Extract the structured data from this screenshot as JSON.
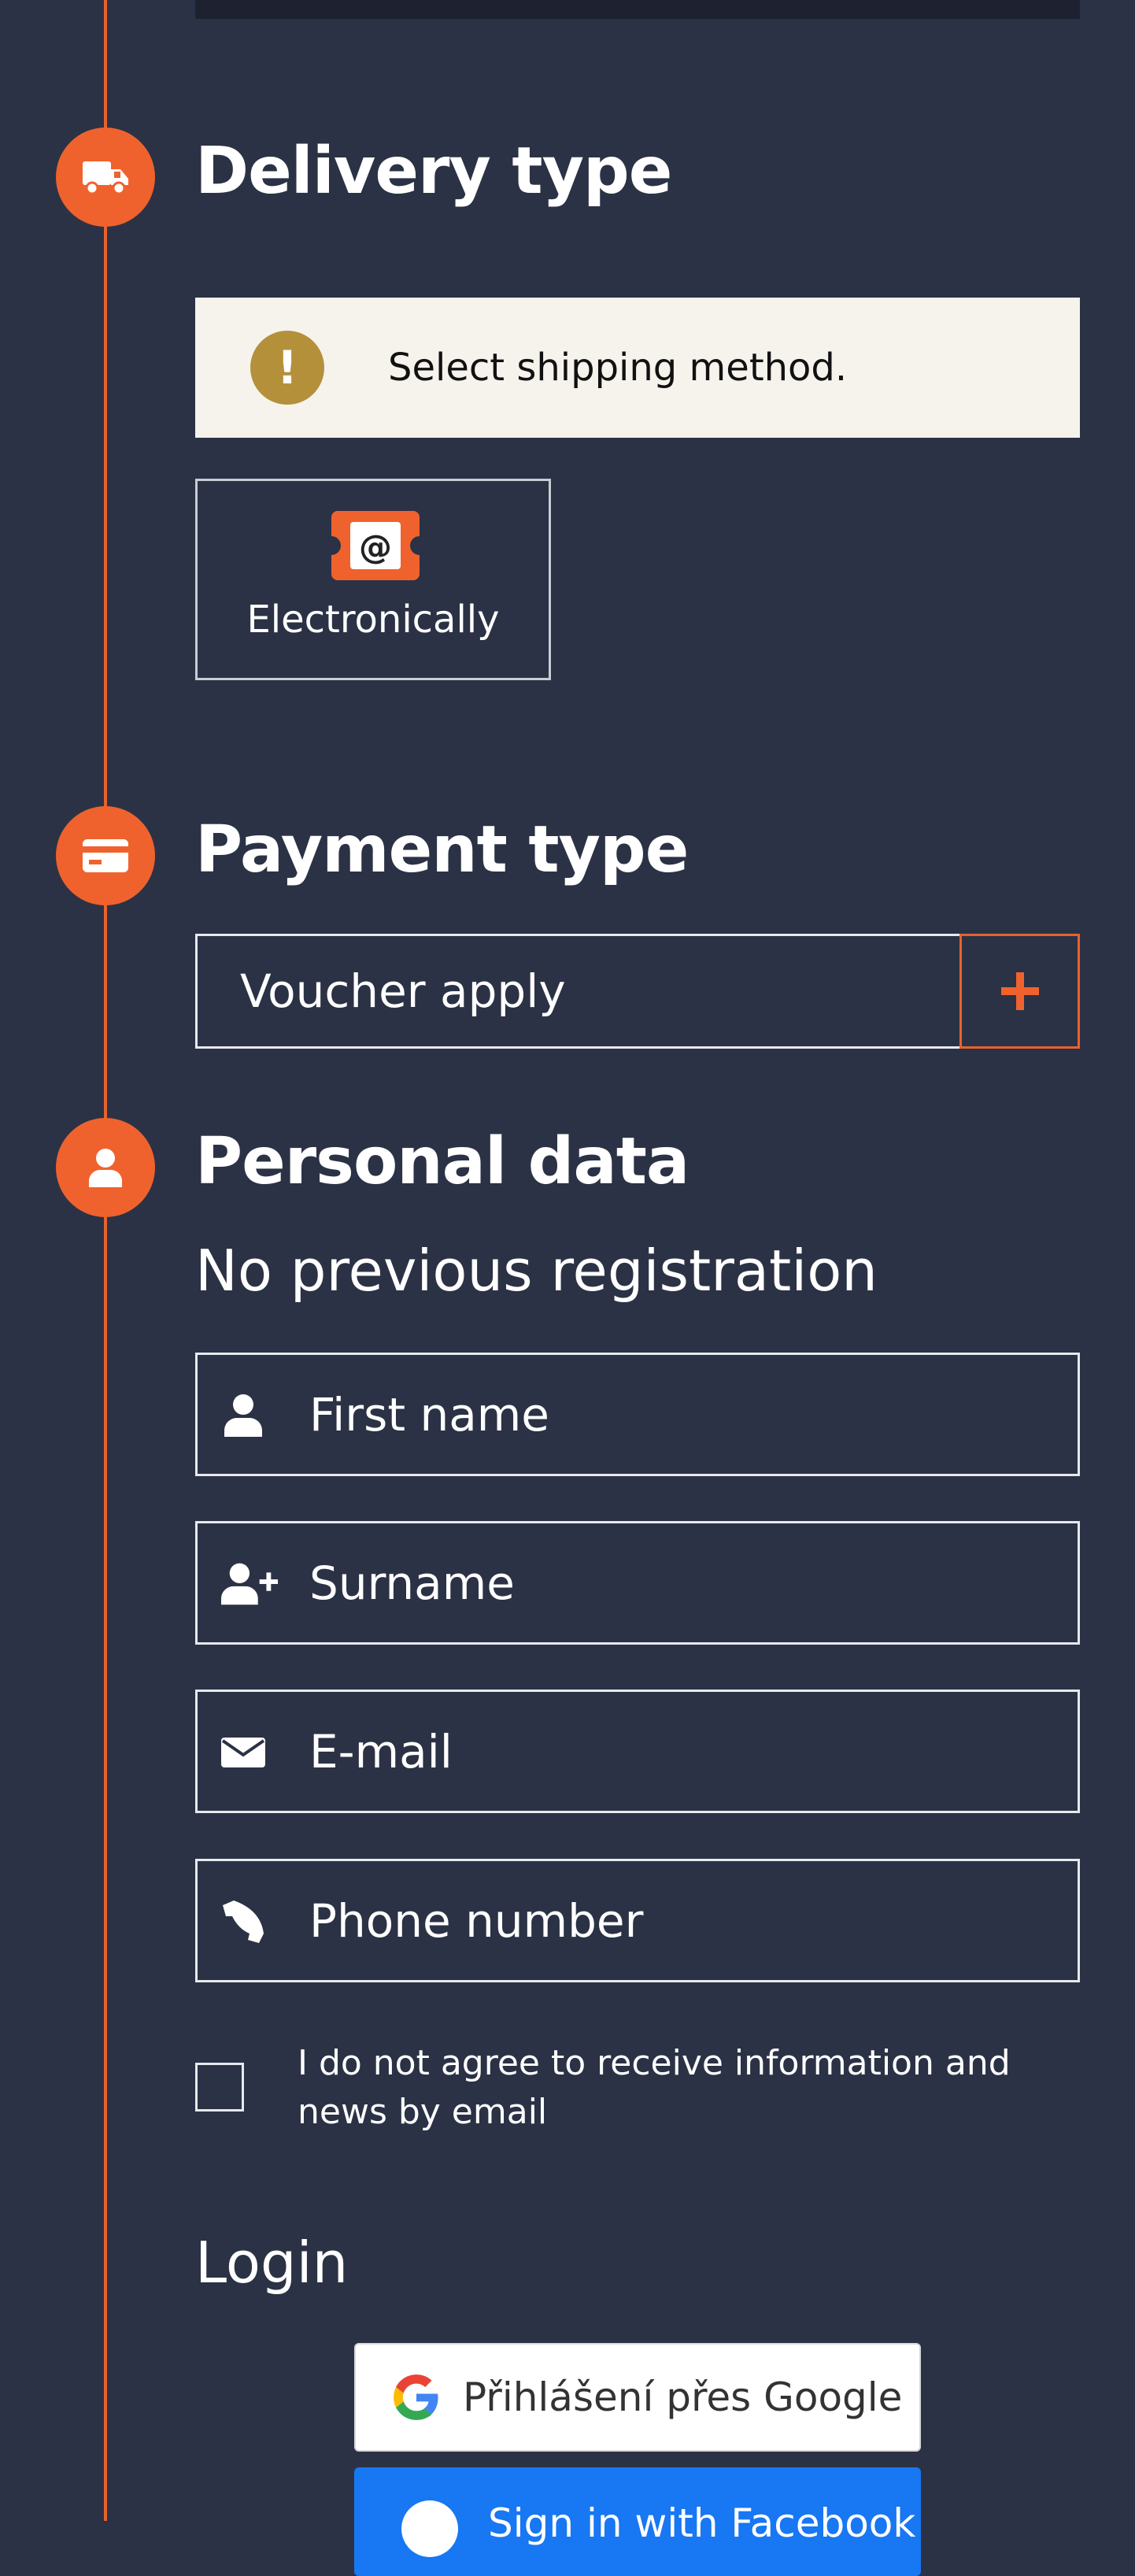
{
  "delivery": {
    "title": "Delivery type",
    "notice": "Select shipping method.",
    "option_label": "Electronically"
  },
  "payment": {
    "title": "Payment type",
    "voucher_label": "Voucher apply"
  },
  "personal": {
    "title": "Personal data",
    "subtitle": "No previous registration",
    "first_name_placeholder": "First name",
    "surname_placeholder": "Surname",
    "email_placeholder": "E-mail",
    "phone_placeholder": "Phone number",
    "newsletter_consent": "I do not agree to receive information and news by email"
  },
  "login": {
    "title": "Login",
    "google_label": "Přihlášení přes Google",
    "facebook_label": "Sign in with Facebook"
  },
  "colors": {
    "background": "#2b3245",
    "accent": "#f0622d",
    "notice_bg": "#f6f3ec",
    "notice_icon": "#b5903b",
    "facebook": "#1877f2"
  }
}
